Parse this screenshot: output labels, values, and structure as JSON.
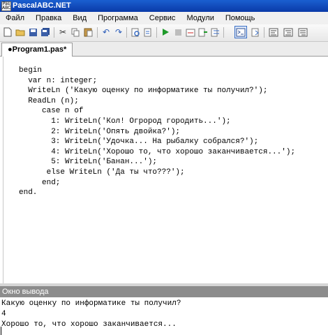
{
  "window": {
    "title": "PascalABC.NET",
    "icon_text": "Pas ABC"
  },
  "menu": [
    "Файл",
    "Правка",
    "Вид",
    "Программа",
    "Сервис",
    "Модули",
    "Помощь"
  ],
  "toolbar_icons": [
    "new-file-icon",
    "open-folder-icon",
    "save-icon",
    "save-all-icon",
    "cut-icon",
    "copy-icon",
    "paste-icon",
    "undo-icon",
    "redo-icon",
    "find-icon",
    "replace-icon",
    "run-icon",
    "stop-icon",
    "compile-icon",
    "step-into-icon",
    "step-over-icon",
    "output-window-icon",
    "debug-icon",
    "format-code-icon",
    "step-out-icon",
    "settings-icon"
  ],
  "tab": {
    "label": "●Program1.pas*"
  },
  "code_lines": [
    "begin",
    "  var n: integer;",
    "  WriteLn ('Какую оценку по информатике ты получил?');",
    "  ReadLn (n);",
    "     case n of",
    "       1: WriteLn('Кол! Огрород городить...');",
    "       2: WriteLn('Опять двойка?');",
    "       3: WriteLn('Удочка... На рыбалку собрался?');",
    "       4: WriteLn('Хорошо то, что хорошо заканчивается...');",
    "       5: WriteLn('Банан...');",
    "      else WriteLn ('Да ты что???');",
    "     end;",
    "end."
  ],
  "output": {
    "title": "Окно вывода",
    "lines": [
      "Какую оценку по информатике ты получил?",
      "4",
      "Хорошо то, что хорошо заканчивается..."
    ]
  }
}
